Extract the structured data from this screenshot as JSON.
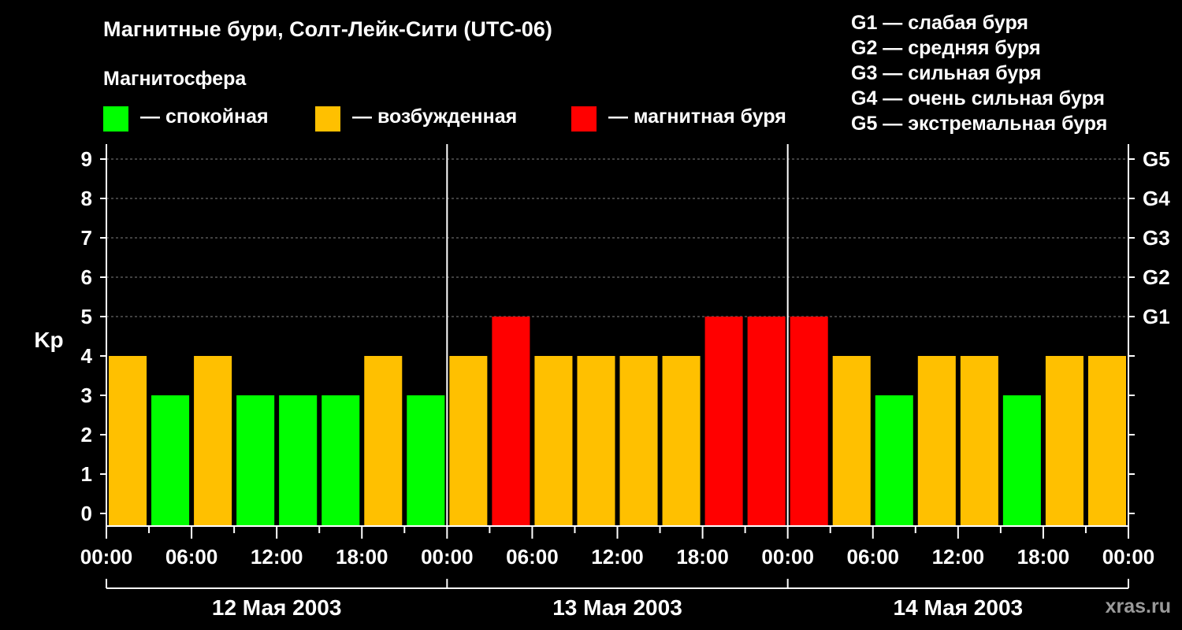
{
  "title": "Магнитные бури, Солт-Лейк-Сити (UTC-06)",
  "subtitle": "Магнитосфера",
  "legend": [
    {
      "label": "— спокойная",
      "color": "#00ff00"
    },
    {
      "label": "— возбужденная",
      "color": "#ffc000"
    },
    {
      "label": "— магнитная буря",
      "color": "#ff0000"
    }
  ],
  "storm_scale": [
    "G1 — слабая буря",
    "G2 — средняя буря",
    "G3 — сильная буря",
    "G4 — очень сильная буря",
    "G5 — экстремальная буря"
  ],
  "watermark": "xras.ru",
  "colors": {
    "quiet": "#00ff00",
    "active": "#ffc000",
    "storm": "#ff0000",
    "background": "#000000",
    "grid": "#808080"
  },
  "chart_data": {
    "type": "bar",
    "ylabel": "Kp",
    "ylim": [
      0,
      9
    ],
    "yticks": [
      0,
      1,
      2,
      3,
      4,
      5,
      6,
      7,
      8,
      9
    ],
    "right_ticks": [
      {
        "value": 5,
        "label": "G1"
      },
      {
        "value": 6,
        "label": "G2"
      },
      {
        "value": 7,
        "label": "G3"
      },
      {
        "value": 8,
        "label": "G4"
      },
      {
        "value": 9,
        "label": "G5"
      }
    ],
    "grid": "dashed horizontal at 5-9",
    "xtick_labels": [
      "00:00",
      "06:00",
      "12:00",
      "18:00",
      "00:00",
      "06:00",
      "12:00",
      "18:00",
      "00:00",
      "06:00",
      "12:00",
      "18:00",
      "00:00"
    ],
    "days": [
      "12 Мая 2003",
      "13 Мая 2003",
      "14 Мая 2003"
    ],
    "interval_hours": 3,
    "values": [
      4,
      3,
      4,
      3,
      3,
      3,
      4,
      3,
      4,
      5,
      4,
      4,
      4,
      4,
      5,
      5,
      5,
      4,
      3,
      4,
      4,
      3,
      4,
      4
    ],
    "categories": [
      "quiet",
      "active",
      "storm"
    ],
    "bar_levels": [
      "active",
      "quiet",
      "active",
      "quiet",
      "quiet",
      "quiet",
      "active",
      "quiet",
      "active",
      "storm",
      "active",
      "active",
      "active",
      "active",
      "storm",
      "storm",
      "storm",
      "active",
      "quiet",
      "active",
      "active",
      "quiet",
      "active",
      "active"
    ]
  }
}
